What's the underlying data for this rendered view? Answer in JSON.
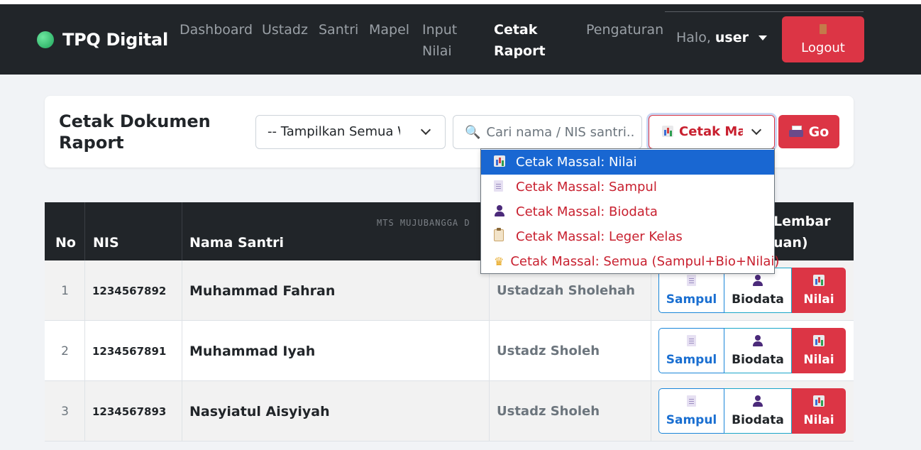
{
  "navbar": {
    "brand": "TPQ Digital",
    "links": [
      {
        "label1": "Dashboard",
        "label2": ""
      },
      {
        "label1": "Ustadz",
        "label2": ""
      },
      {
        "label1": "Santri",
        "label2": ""
      },
      {
        "label1": "Mapel",
        "label2": ""
      },
      {
        "label1": "Input",
        "label2": "Nilai"
      },
      {
        "label1": "Cetak",
        "label2": "Raport"
      },
      {
        "label1": "Pengaturan",
        "label2": ""
      }
    ],
    "active_link": "Cetak Raport",
    "greeting": "Halo,",
    "username": "user",
    "logout_label": "Logout"
  },
  "toolbar": {
    "title_line1": "Cetak Dokumen",
    "title_line2": "Raport",
    "kelas_select_value": "-- Tampilkan Semua Wali Kelas --",
    "search_placeholder": "Cari nama / NIS santri...",
    "cetak_select_value": "Cetak Massal: Nilai",
    "go_label": "Go"
  },
  "dropdown": {
    "options": [
      {
        "label": "Cetak Massal: Nilai",
        "icon": "chart-icon",
        "selected": true
      },
      {
        "label": "Cetak Massal: Sampul",
        "icon": "document-icon",
        "selected": false
      },
      {
        "label": "Cetak Massal: Biodata",
        "icon": "person-icon",
        "selected": false
      },
      {
        "label": "Cetak Massal: Leger Kelas",
        "icon": "clipboard-icon",
        "selected": false
      },
      {
        "label": "Cetak Massal: Semua (Sampul+Bio+Nilai)",
        "icon": "crown-icon",
        "selected": false
      }
    ]
  },
  "table": {
    "headers": {
      "no": "No",
      "nis": "NIS",
      "nama": "Nama Santri",
      "aksi_line1": "Lembar",
      "aksi_line2": "uan)"
    },
    "watermark": "MTS MUJUBANGGA D",
    "rows": [
      {
        "no": "1",
        "nis": "1234567892",
        "nama": "Muhammad Fahran",
        "wali": "Ustadzah Sholehah"
      },
      {
        "no": "2",
        "nis": "1234567891",
        "nama": "Muhammad Iyah",
        "wali": "Ustadz Sholeh"
      },
      {
        "no": "3",
        "nis": "1234567893",
        "nama": "Nasyiatul Aisyiyah",
        "wali": "Ustadz Sholeh"
      }
    ],
    "button_labels": {
      "sampul": "Sampul",
      "biodata": "Biodata",
      "nilai": "Nilai"
    }
  },
  "colors": {
    "navbar_bg": "#212529",
    "accent_red": "#dc3545",
    "dropdown_selected": "#1967d2",
    "sampul_blue": "#1a6fd1"
  }
}
